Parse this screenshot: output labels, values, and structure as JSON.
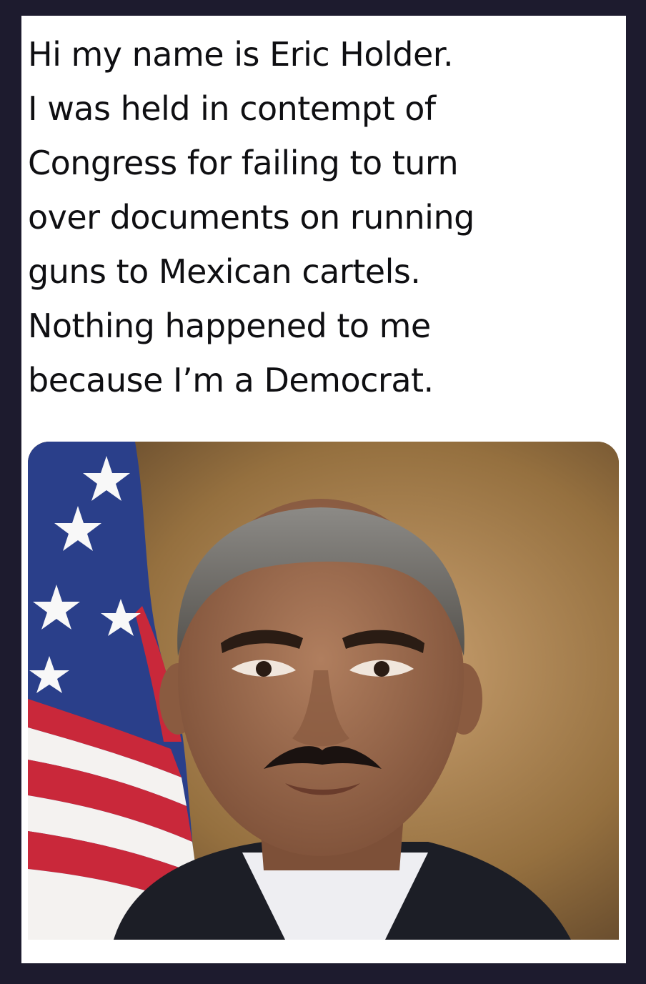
{
  "post": {
    "lines": [
      "Hi my name is Eric Holder.",
      "I was held in contempt of",
      "Congress for failing to turn",
      "over documents on running",
      "guns to Mexican cartels.",
      "Nothing happened to me",
      "because I’m a Democrat."
    ]
  },
  "photo": {
    "subject": "portrait-photo",
    "colors": {
      "background_light": "#c9a070",
      "background_dark": "#5a4128",
      "flag_red": "#c9283a",
      "flag_blue": "#2a3f8a",
      "suit": "#1c1e26",
      "shirt": "#eeeef2",
      "skin": "#9a6a4e"
    }
  }
}
